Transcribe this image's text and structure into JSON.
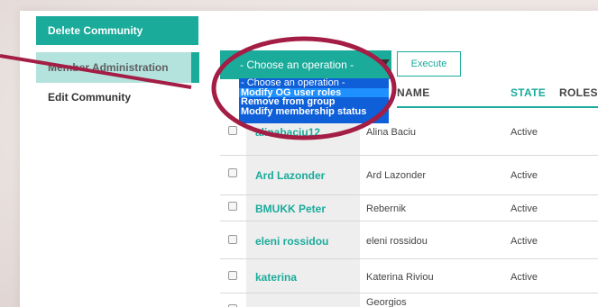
{
  "sidebar": {
    "items": [
      {
        "label": "Delete Community"
      },
      {
        "label": "Member Administration"
      },
      {
        "label": "Edit Community"
      }
    ]
  },
  "operations": {
    "selected": "- Choose an operation -",
    "execute_label": "Execute",
    "options": [
      "- Choose an operation -",
      "Modify OG user roles",
      "Remove from group",
      "Modify membership status"
    ]
  },
  "table": {
    "headers": {
      "name": "NAME",
      "state": "STATE",
      "roles": "ROLES"
    },
    "rows": [
      {
        "user": "alinabaciu12",
        "name": "Alina Baciu",
        "state": "Active"
      },
      {
        "user": "Ard Lazonder",
        "name": "Ard Lazonder",
        "state": "Active"
      },
      {
        "user": "BMUKK Peter",
        "name": "Rebernik",
        "state": "Active"
      },
      {
        "user": "eleni rossidou",
        "name": "eleni rossidou",
        "state": "Active"
      },
      {
        "user": "katerina",
        "name": "Katerina Riviou",
        "state": "Active"
      },
      {
        "user": "",
        "name": "Georgios",
        "state": ""
      }
    ]
  },
  "colors": {
    "accent": "#1aab9b",
    "accent_light": "#b4e3de",
    "annotation": "#a31d44",
    "dropdown_bg": "#0e5fd8"
  }
}
